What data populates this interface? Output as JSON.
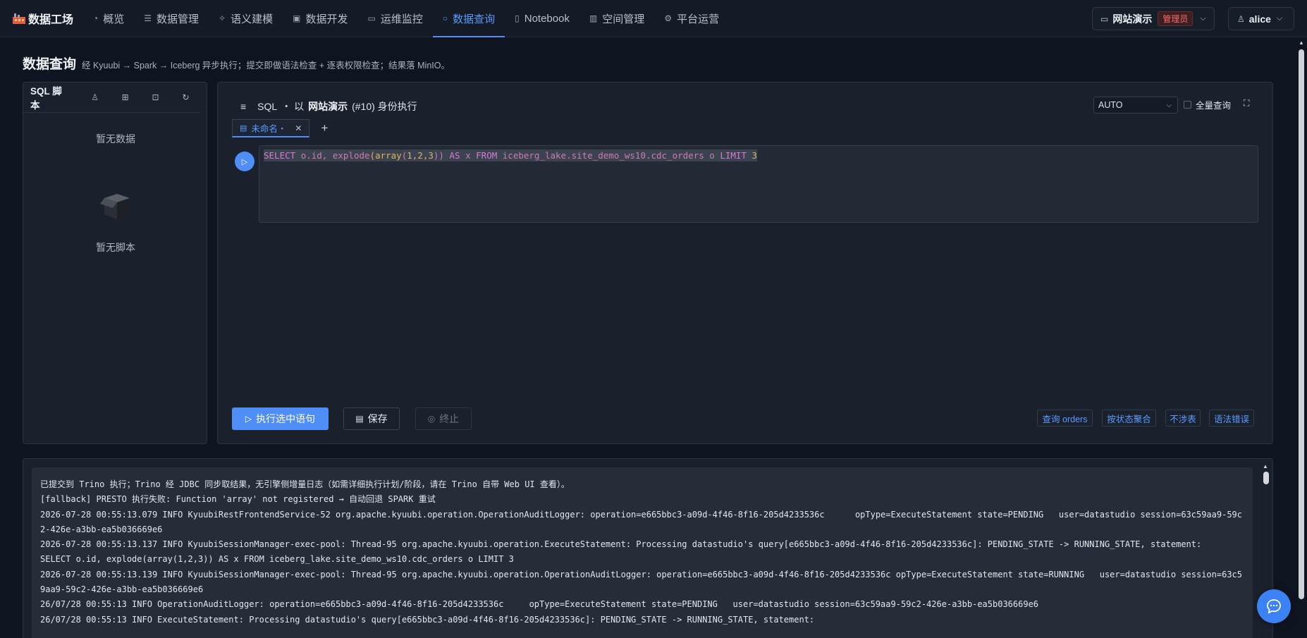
{
  "brand": {
    "title": "数据工场"
  },
  "nav": [
    {
      "id": "overview",
      "icon": "dashboard-icon",
      "label": "概览"
    },
    {
      "id": "data-mgmt",
      "icon": "database-icon",
      "label": "数据管理"
    },
    {
      "id": "semantic",
      "icon": "sparkle-icon",
      "label": "语义建模"
    },
    {
      "id": "dev",
      "icon": "code-file-icon",
      "label": "数据开发"
    },
    {
      "id": "ops",
      "icon": "monitor-icon",
      "label": "运维监控"
    },
    {
      "id": "query",
      "icon": "search-icon",
      "label": "数据查询",
      "active": true
    },
    {
      "id": "notebook",
      "icon": "notebook-icon",
      "label": "Notebook"
    },
    {
      "id": "space",
      "icon": "building-icon",
      "label": "空间管理"
    },
    {
      "id": "platform",
      "icon": "gear-icon",
      "label": "平台运营"
    }
  ],
  "workspace": {
    "name": "网站演示",
    "role": "管理员"
  },
  "user": {
    "name": "alice"
  },
  "page": {
    "title": "数据查询",
    "subtitle": "经 Kyuubi → Spark → Iceberg 异步执行；提交即做语法检查 + 逐表权限检查；结果落 MinIO。"
  },
  "scripts_panel": {
    "title": "SQL 脚本",
    "empty_data": "暂无数据",
    "empty_scripts": "暂无脚本"
  },
  "editor": {
    "lang": "SQL",
    "sep": "・ 以",
    "identity": "网站演示",
    "identity_suffix": "(#10) 身份执行",
    "engine": "AUTO",
    "full_query_label": "全量查询",
    "tab_label": "未命名・",
    "sql": {
      "select": "SELECT",
      "col1": "o.id,",
      "explode": "explode",
      "p1": "(",
      "array": "array",
      "p2": "(",
      "nums": "1,2,3",
      "p3": "))",
      "as": "AS",
      "x": "x",
      "from": "FROM",
      "table": "iceberg_lake.site_demo_ws10.cdc_orders",
      "alias": "o",
      "limit": "LIMIT",
      "n": "3"
    },
    "buttons": {
      "run": "执行选中语句",
      "save": "保存",
      "stop": "终止"
    },
    "quick": [
      "查询 orders",
      "按状态聚合",
      "不涉表",
      "语法错误"
    ]
  },
  "log": [
    "已提交到 Trino 执行；Trino 经 JDBC 同步取结果，无引擎侧增量日志（如需详细执行计划/阶段，请在 Trino 自带 Web UI 查看）。",
    "[fallback] PRESTO 执行失败: Function 'array' not registered → 自动回退 SPARK 重试",
    "2026-07-28 00:55:13.079 INFO KyuubiRestFrontendService-52 org.apache.kyuubi.operation.OperationAuditLogger: operation=e665bbc3-a09d-4f46-8f16-205d4233536c      opType=ExecuteStatement state=PENDING   user=datastudio session=63c59aa9-59c2-426e-a3bb-ea5b036669e6",
    "2026-07-28 00:55:13.137 INFO KyuubiSessionManager-exec-pool: Thread-95 org.apache.kyuubi.operation.ExecuteStatement: Processing datastudio's query[e665bbc3-a09d-4f46-8f16-205d4233536c]: PENDING_STATE -> RUNNING_STATE, statement:",
    "SELECT o.id, explode(array(1,2,3)) AS x FROM iceberg_lake.site_demo_ws10.cdc_orders o LIMIT 3",
    "2026-07-28 00:55:13.139 INFO KyuubiSessionManager-exec-pool: Thread-95 org.apache.kyuubi.operation.OperationAuditLogger: operation=e665bbc3-a09d-4f46-8f16-205d4233536c opType=ExecuteStatement state=RUNNING   user=datastudio session=63c59aa9-59c2-426e-a3bb-ea5b036669e6",
    "26/07/28 00:55:13 INFO OperationAuditLogger: operation=e665bbc3-a09d-4f46-8f16-205d4233536c     opType=ExecuteStatement state=PENDING   user=datastudio session=63c59aa9-59c2-426e-a3bb-ea5b036669e6",
    "26/07/28 00:55:13 INFO ExecuteStatement: Processing datastudio's query[e665bbc3-a09d-4f46-8f16-205d4233536c]: PENDING_STATE -> RUNNING_STATE, statement:"
  ],
  "colors": {
    "accent": "#4f8ef7",
    "danger": "#ff6b6b",
    "bg": "#0f1520",
    "panel": "#1a212d"
  }
}
